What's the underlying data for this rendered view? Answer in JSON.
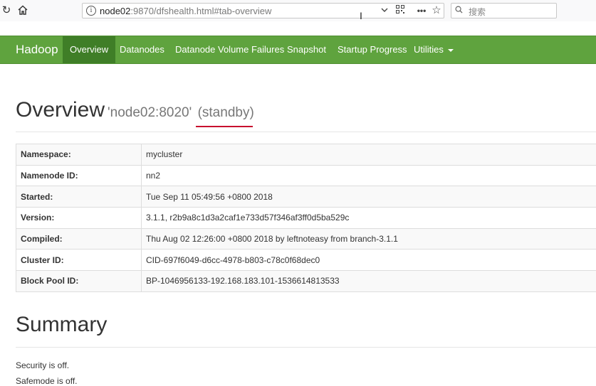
{
  "browser": {
    "url_host": "node02",
    "url_rest": ":9870/dfshealth.html#tab-overview",
    "search_placeholder": "搜索"
  },
  "navbar": {
    "brand": "Hadoop",
    "items": [
      {
        "label": "Overview"
      },
      {
        "label": "Datanodes"
      },
      {
        "label": "Datanode Volume Failures"
      },
      {
        "label": "Snapshot"
      },
      {
        "label": "Startup Progress"
      },
      {
        "label": "Utilities"
      }
    ]
  },
  "overview": {
    "title": "Overview",
    "subtitle_node": "'node02:8020'",
    "subtitle_state": "(standby)",
    "rows": [
      {
        "key": "Namespace:",
        "value": "mycluster"
      },
      {
        "key": "Namenode ID:",
        "value": "nn2"
      },
      {
        "key": "Started:",
        "value": "Tue Sep 11 05:49:56 +0800 2018"
      },
      {
        "key": "Version:",
        "value": "3.1.1, r2b9a8c1d3a2caf1e733d57f346af3ff0d5ba529c"
      },
      {
        "key": "Compiled:",
        "value": "Thu Aug 02 12:26:00 +0800 2018 by leftnoteasy from branch-3.1.1"
      },
      {
        "key": "Cluster ID:",
        "value": "CID-697f6049-d6cc-4978-b803-c78c0f68dec0"
      },
      {
        "key": "Block Pool ID:",
        "value": "BP-1046956133-192.168.183.101-1536614813533"
      }
    ]
  },
  "summary": {
    "title": "Summary",
    "lines": [
      "Security is off.",
      "Safemode is off."
    ]
  }
}
